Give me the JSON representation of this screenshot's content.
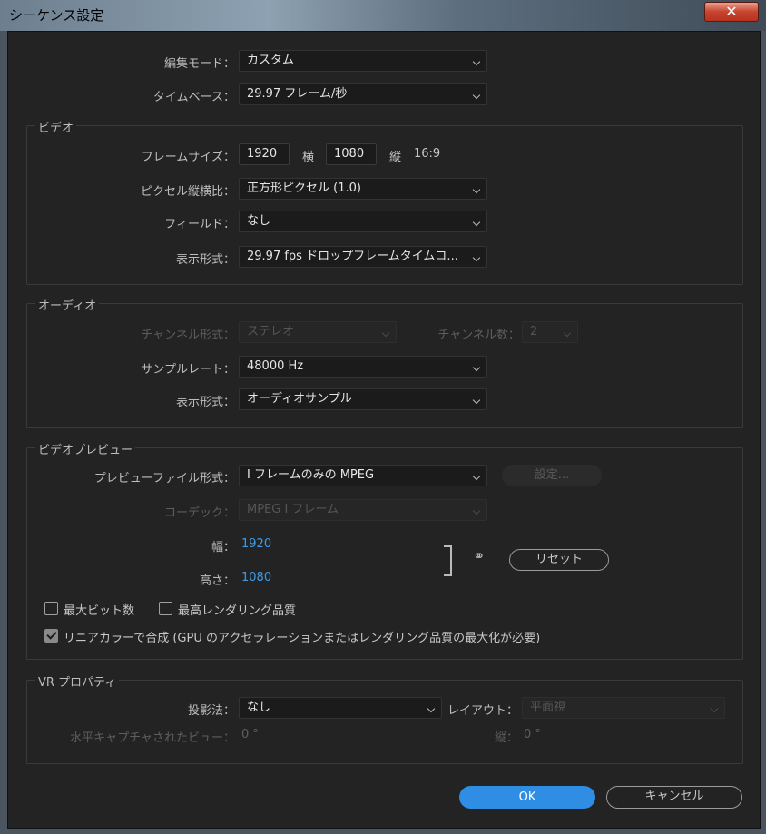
{
  "window": {
    "title": "シーケンス設定",
    "close_label": "✕"
  },
  "general": {
    "edit_mode_label": "編集モード：",
    "edit_mode_value": "カスタム",
    "timebase_label": "タイムベース：",
    "timebase_value": "29.97  フレーム/秒"
  },
  "video": {
    "title": "ビデオ",
    "frame_size_label": "フレームサイズ：",
    "frame_width": "1920",
    "h_label": "横",
    "frame_height": "1080",
    "v_label": "縦",
    "aspect": "16:9",
    "pixel_aspect_label": "ピクセル縦横比：",
    "pixel_aspect_value": "正方形ピクセル (1.0)",
    "field_label": "フィールド：",
    "field_value": "なし",
    "display_format_label": "表示形式：",
    "display_format_value": "29.97 fps ドロップフレームタイムコ..."
  },
  "audio": {
    "title": "オーディオ",
    "channel_format_label": "チャンネル形式：",
    "channel_format_value": "ステレオ",
    "channel_count_label": "チャンネル数：",
    "channel_count_value": "2",
    "sample_rate_label": "サンプルレート：",
    "sample_rate_value": "48000 Hz",
    "display_format_label": "表示形式：",
    "display_format_value": "オーディオサンプル"
  },
  "preview": {
    "title": "ビデオプレビュー",
    "file_format_label": "プレビューファイル形式：",
    "file_format_value": "I フレームのみの MPEG",
    "settings_button": "設定...",
    "codec_label": "コーデック：",
    "codec_value": "MPEG I フレーム",
    "width_label": "幅：",
    "width_value": "1920",
    "height_label": "高さ：",
    "height_value": "1080",
    "reset_button": "リセット",
    "max_bit_depth_label": "最大ビット数",
    "max_render_quality_label": "最高レンダリング品質",
    "linear_color_label": "リニアカラーで合成 (GPU のアクセラレーションまたはレンダリング品質の最大化が必要)"
  },
  "vr": {
    "title": "VR プロパティ",
    "projection_label": "投影法：",
    "projection_value": "なし",
    "layout_label": "レイアウト：",
    "layout_value": "平面視",
    "h_captured_label": "水平キャプチャされたビュー：",
    "h_captured_value": "0 °",
    "vertical_label": "縦：",
    "vertical_value": "0 °"
  },
  "buttons": {
    "ok": "OK",
    "cancel": "キャンセル"
  },
  "colors": {
    "accent": "#2f8de4",
    "value_blue": "#3d9be9",
    "bg": "#232323"
  }
}
